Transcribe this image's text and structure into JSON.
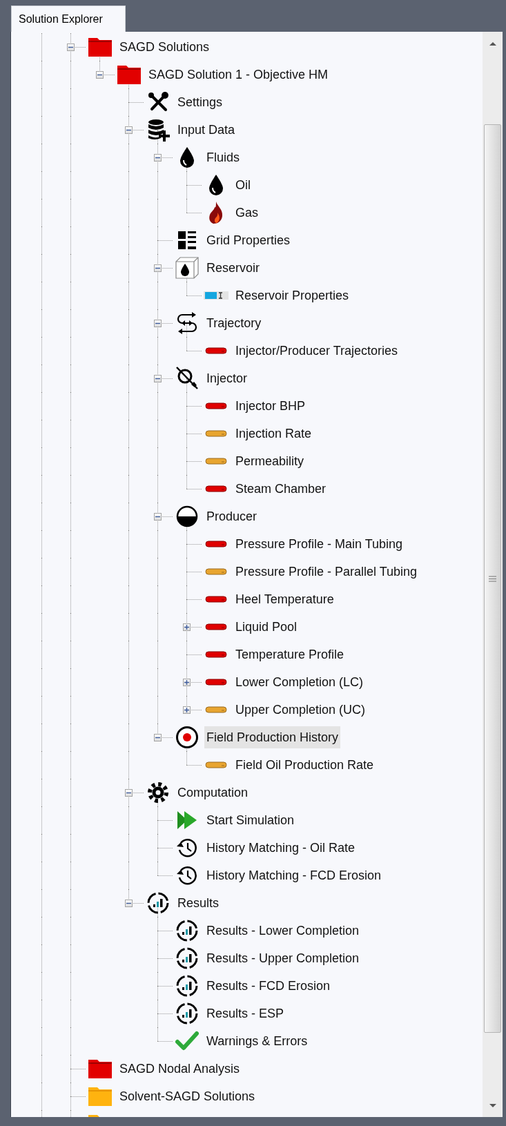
{
  "tab": {
    "label": "Solution Explorer",
    "selected": true
  },
  "tree": [
    {
      "label": "SAGD Solutions",
      "kind": "folder_red",
      "expanded": true,
      "selected": false,
      "children": [
        {
          "label": "SAGD Solution 1 - Objective HM",
          "kind": "folder_red",
          "expanded": true,
          "selected": false,
          "children": [
            {
              "label": "Settings",
              "kind": "tools",
              "selected": false
            },
            {
              "label": "Input Data",
              "kind": "database_add",
              "expanded": true,
              "selected": false,
              "children": [
                {
                  "label": "Fluids",
                  "kind": "drop",
                  "expanded": true,
                  "selected": false,
                  "children": [
                    {
                      "label": "Oil",
                      "kind": "drop",
                      "selected": false
                    },
                    {
                      "label": "Gas",
                      "kind": "flame",
                      "selected": false
                    }
                  ]
                },
                {
                  "label": "Grid Properties",
                  "kind": "grid_list",
                  "selected": false
                },
                {
                  "label": "Reservoir",
                  "kind": "cube_drop",
                  "expanded": true,
                  "selected": false,
                  "children": [
                    {
                      "label": "Reservoir Properties",
                      "kind": "bar_blue",
                      "selected": false
                    }
                  ]
                },
                {
                  "label": "Trajectory",
                  "kind": "arrows",
                  "expanded": true,
                  "selected": false,
                  "children": [
                    {
                      "label": "Injector/Producer Trajectories",
                      "kind": "bar_red",
                      "selected": false
                    }
                  ]
                },
                {
                  "label": "Injector",
                  "kind": "gauge",
                  "expanded": true,
                  "selected": false,
                  "children": [
                    {
                      "label": "Injector BHP",
                      "kind": "bar_red",
                      "selected": false
                    },
                    {
                      "label": "Injection Rate",
                      "kind": "bar_orange",
                      "selected": false
                    },
                    {
                      "label": "Permeability",
                      "kind": "bar_orange",
                      "selected": false
                    },
                    {
                      "label": "Steam Chamber",
                      "kind": "bar_red",
                      "selected": false
                    }
                  ]
                },
                {
                  "label": "Producer",
                  "kind": "half_circle",
                  "expanded": true,
                  "selected": false,
                  "children": [
                    {
                      "label": "Pressure Profile - Main Tubing",
                      "kind": "bar_red",
                      "selected": false
                    },
                    {
                      "label": "Pressure Profile - Parallel Tubing",
                      "kind": "bar_orange",
                      "selected": false
                    },
                    {
                      "label": "Heel Temperature",
                      "kind": "bar_red",
                      "selected": false
                    },
                    {
                      "label": "Liquid Pool",
                      "kind": "bar_red",
                      "expanded": false,
                      "selected": false
                    },
                    {
                      "label": "Temperature Profile",
                      "kind": "bar_red",
                      "selected": false
                    },
                    {
                      "label": "Lower Completion (LC)",
                      "kind": "bar_red",
                      "expanded": false,
                      "selected": false
                    },
                    {
                      "label": "Upper Completion (UC)",
                      "kind": "bar_orange",
                      "expanded": false,
                      "selected": false
                    }
                  ]
                },
                {
                  "label": "Field Production History",
                  "kind": "target",
                  "expanded": true,
                  "selected": true,
                  "children": [
                    {
                      "label": "Field Oil Production Rate",
                      "kind": "bar_orange",
                      "selected": false
                    }
                  ]
                }
              ]
            },
            {
              "label": "Computation",
              "kind": "gear",
              "expanded": true,
              "selected": false,
              "children": [
                {
                  "label": "Start Simulation",
                  "kind": "play",
                  "selected": false
                },
                {
                  "label": "History Matching - Oil Rate",
                  "kind": "history",
                  "selected": false
                },
                {
                  "label": "History Matching - FCD Erosion",
                  "kind": "history",
                  "selected": false
                }
              ]
            },
            {
              "label": "Results",
              "kind": "results",
              "expanded": true,
              "selected": false,
              "children": [
                {
                  "label": "Results - Lower Completion",
                  "kind": "results",
                  "selected": false
                },
                {
                  "label": "Results - Upper Completion",
                  "kind": "results",
                  "selected": false
                },
                {
                  "label": "Results - FCD Erosion",
                  "kind": "results",
                  "selected": false
                },
                {
                  "label": "Results - ESP",
                  "kind": "results",
                  "selected": false
                },
                {
                  "label": "Warnings & Errors",
                  "kind": "check",
                  "selected": false
                }
              ]
            }
          ]
        }
      ]
    },
    {
      "label": "SAGD Nodal Analysis",
      "kind": "folder_red",
      "selected": false
    },
    {
      "label": "Solvent-SAGD Solutions",
      "kind": "folder_orange",
      "selected": false
    },
    {
      "kind": "folder_orange"
    }
  ]
}
